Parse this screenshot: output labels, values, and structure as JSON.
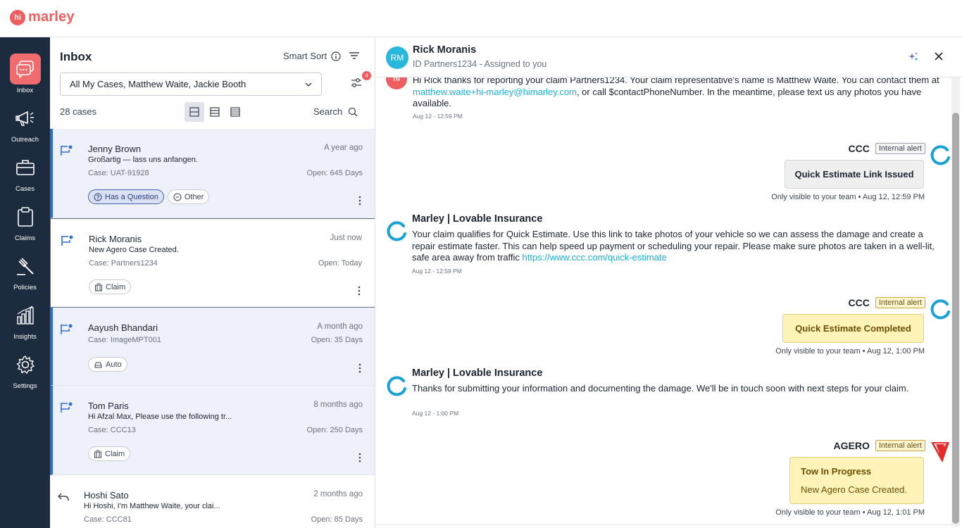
{
  "brand": {
    "logo_mark": "hi",
    "logo_text": "marley"
  },
  "nav": [
    {
      "label": "Inbox",
      "icon": "inbox-icon",
      "active": true
    },
    {
      "label": "Outreach",
      "icon": "megaphone-icon"
    },
    {
      "label": "Cases",
      "icon": "briefcase-icon"
    },
    {
      "label": "Claims",
      "icon": "clipboard-icon"
    },
    {
      "label": "Policies",
      "icon": "gavel-icon"
    },
    {
      "label": "Insights",
      "icon": "bar-chart-icon"
    },
    {
      "label": "Settings",
      "icon": "gear-icon"
    }
  ],
  "inbox": {
    "title": "Inbox",
    "smart_sort": "Smart Sort",
    "filter_value": "All My Cases, Matthew Waite, Jackie Booth",
    "filter_badge": "4",
    "count": "28 cases",
    "search": "Search",
    "cases": [
      {
        "name": "Jenny Brown",
        "time": "A year ago",
        "preview": "Großartig — lass uns anfangen.",
        "case_no": "Case: UAT-91928",
        "open": "Open: 645 Days",
        "tags": [
          "Has a Question",
          "Other"
        ]
      },
      {
        "name": "Rick Moranis",
        "time": "Just now",
        "preview": "New Agero Case Created.",
        "case_no": "Case: Partners1234",
        "open": "Open: Today",
        "tags": [
          "Claim"
        ]
      },
      {
        "name": "Aayush Bhandari",
        "time": "A month ago",
        "preview": "",
        "case_no": "Case: ImageMPT001",
        "open": "Open: 35 Days",
        "tags": [
          "Auto"
        ]
      },
      {
        "name": "Tom Paris",
        "time": "8 months ago",
        "preview": "Hi Afzal Max, Please use the following tr...",
        "case_no": "Case: CCC13",
        "open": "Open: 250 Days",
        "tags": [
          "Claim"
        ]
      },
      {
        "name": "Hoshi Sato",
        "time": "2 months ago",
        "preview": "Hi Hoshi, I'm Matthew Waite, your clai...",
        "case_no": "Case: CCC81",
        "open": "Open: 85 Days",
        "tags": []
      }
    ]
  },
  "conversation": {
    "avatar": "RM",
    "name": "Rick Moranis",
    "subtitle": "ID Partners1234 - Assigned to you",
    "messages": {
      "m1_pre": "Hi Rick thanks for reporting your claim Partners1234. Your claim representative's name is Matthew Waite. You can contact them at ",
      "m1_link": "matthew.waite+hi-marley@himarley.com",
      "m1_post": ", or call $contactPhoneNumber. In the meantime, please text us any photos you have available.",
      "m1_time": "Aug 12 - 12:59 PM",
      "a1_sender": "CCC",
      "a1_badge": "Internal alert",
      "a1_card": "Quick Estimate Link Issued",
      "a1_note": "Only visible to your team • Aug 12, 12:59 PM",
      "m2_sender": "Marley | Lovable Insurance",
      "m2_pre": "Your claim qualifies for Quick Estimate. Use this link to take photos of your vehicle so we can assess the damage and create a repair estimate faster. This can help speed up payment or scheduling your repair. Please make sure photos are taken in a well-lit, safe area away from traffic ",
      "m2_link": "https://www.ccc.com/quick-estimate",
      "m2_time": "Aug 12 - 12:59 PM",
      "a2_sender": "CCC",
      "a2_badge": "Internal alert",
      "a2_card": "Quick Estimate Completed",
      "a2_note": "Only visible to your team • Aug 12, 1:00 PM",
      "m3_sender": "Marley | Lovable Insurance",
      "m3_text": "Thanks for submitting your information and documenting the damage. We'll be in touch soon with next steps for your claim.",
      "m3_time": "Aug 12 - 1:00 PM",
      "a3_sender": "AGERO",
      "a3_badge": "Internal alert",
      "a3_title": "Tow In Progress",
      "a3_body": "New Agero Case Created.",
      "a3_note": "Only visible to your team • Aug 12, 1:01 PM"
    }
  },
  "colors": {
    "brand": "#ef5e61",
    "nav_bg": "#1c2b3e",
    "link": "#1bb1d8",
    "accent_blue": "#2f6fd1"
  }
}
